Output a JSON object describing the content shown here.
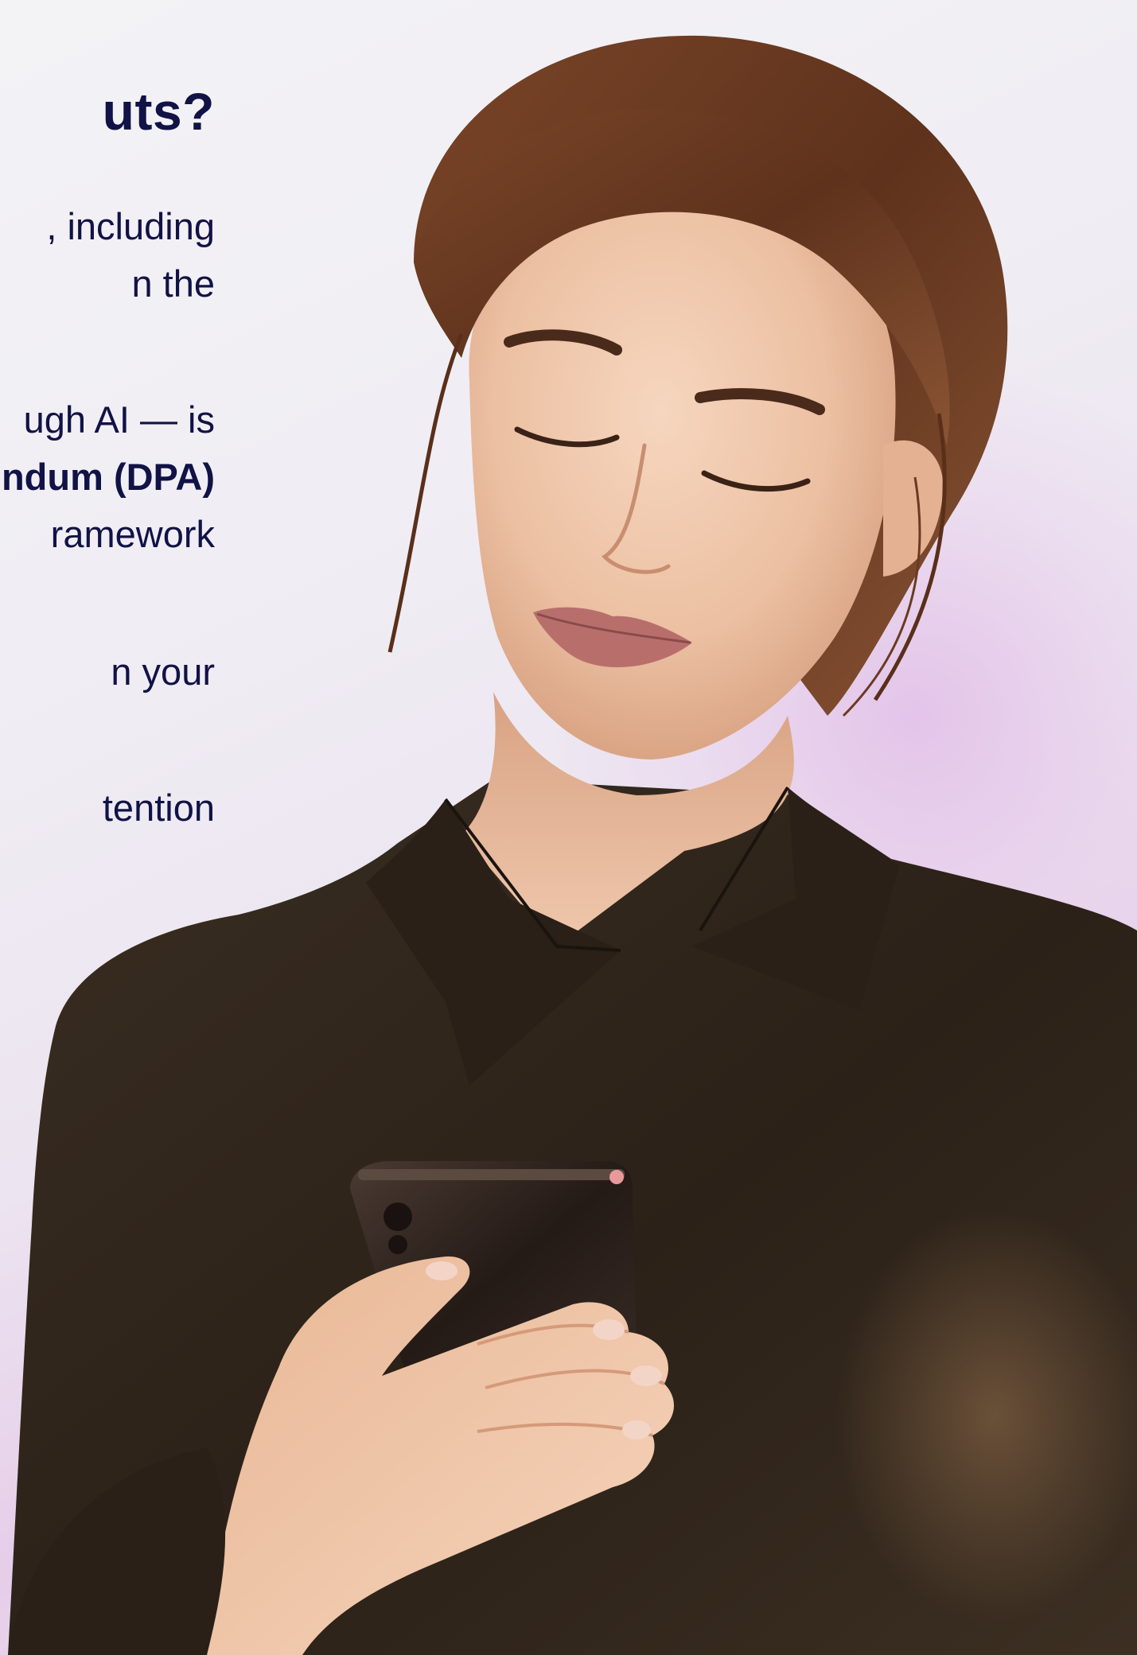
{
  "article": {
    "heading": "uts?",
    "paragraphs": [
      {
        "lines": [
          ", including",
          "n the"
        ]
      },
      {
        "lines": [
          "ugh AI — is",
          "ndum (DPA)",
          "ramework"
        ]
      },
      {
        "lines": [
          "n your"
        ]
      },
      {
        "lines": [
          "tention"
        ]
      }
    ]
  },
  "image": {
    "subject": "woman-holding-phone-photo"
  },
  "colors": {
    "text": "#111246",
    "background": "#f0eef4",
    "glow": "#e6cde9",
    "sweater": "#2e2418",
    "hair": "#6b3a22",
    "skin": "#eec4a8"
  }
}
